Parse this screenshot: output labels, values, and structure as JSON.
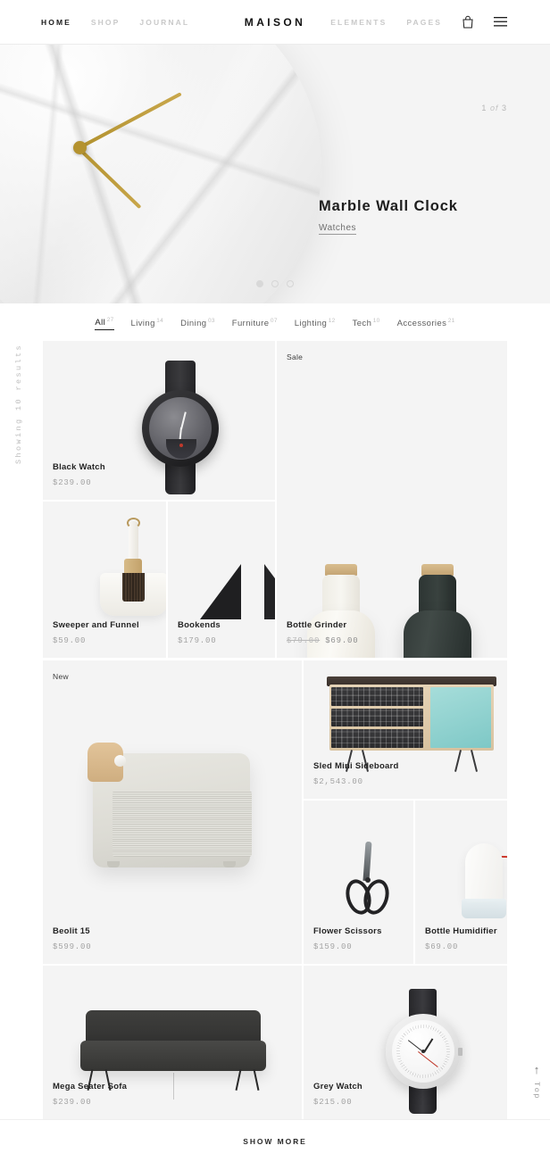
{
  "header": {
    "brand": "MAISON",
    "nav_left": [
      {
        "label": "HOME",
        "active": true
      },
      {
        "label": "SHOP",
        "active": false
      },
      {
        "label": "JOURNAL",
        "active": false
      }
    ],
    "nav_right": [
      {
        "label": "ELEMENTS"
      },
      {
        "label": "PAGES"
      }
    ],
    "cart_icon": "shopping-bag-icon",
    "menu_icon": "hamburger-menu-icon"
  },
  "hero": {
    "counter_current": "1",
    "counter_separator": "of",
    "counter_total": "3",
    "title": "Marble Wall Clock",
    "category": "Watches",
    "slides": 3,
    "active_slide": 1
  },
  "filters": [
    {
      "label": "All",
      "count": "27",
      "active": true
    },
    {
      "label": "Living",
      "count": "14",
      "active": false
    },
    {
      "label": "Dining",
      "count": "03",
      "active": false
    },
    {
      "label": "Furniture",
      "count": "07",
      "active": false
    },
    {
      "label": "Lighting",
      "count": "12",
      "active": false
    },
    {
      "label": "Tech",
      "count": "10",
      "active": false
    },
    {
      "label": "Accessories",
      "count": "21",
      "active": false
    }
  ],
  "sidebar": {
    "showing_results": "Showing 10 results"
  },
  "scroll_top": {
    "arrow": "arrow-up-icon",
    "label": "Top"
  },
  "products": [
    {
      "name": "Black Watch",
      "price": "$239.00",
      "badge": ""
    },
    {
      "name": "Bottle Grinder",
      "price_old": "$79.00",
      "price": "$69.00",
      "badge": "Sale"
    },
    {
      "name": "Sweeper and Funnel",
      "price": "$59.00",
      "badge": ""
    },
    {
      "name": "Bookends",
      "price": "$179.00",
      "badge": ""
    },
    {
      "name": "Beolit 15",
      "price": "$599.00",
      "badge": "New"
    },
    {
      "name": "Sled Mini Sideboard",
      "price": "$2,543.00",
      "badge": ""
    },
    {
      "name": "Flower Scissors",
      "price": "$159.00",
      "badge": ""
    },
    {
      "name": "Bottle Humidifier",
      "price": "$69.00",
      "badge": ""
    },
    {
      "name": "Mega Seater Sofa",
      "price": "$239.00",
      "badge": ""
    },
    {
      "name": "Grey Watch",
      "price": "$215.00",
      "badge": ""
    }
  ],
  "footer": {
    "show_more": "SHOW MORE"
  },
  "colors": {
    "card_bg": "#f4f4f4",
    "text_dark": "#242424",
    "text_muted": "#a3a3a3",
    "accent_sale": "#8e8e8e"
  }
}
